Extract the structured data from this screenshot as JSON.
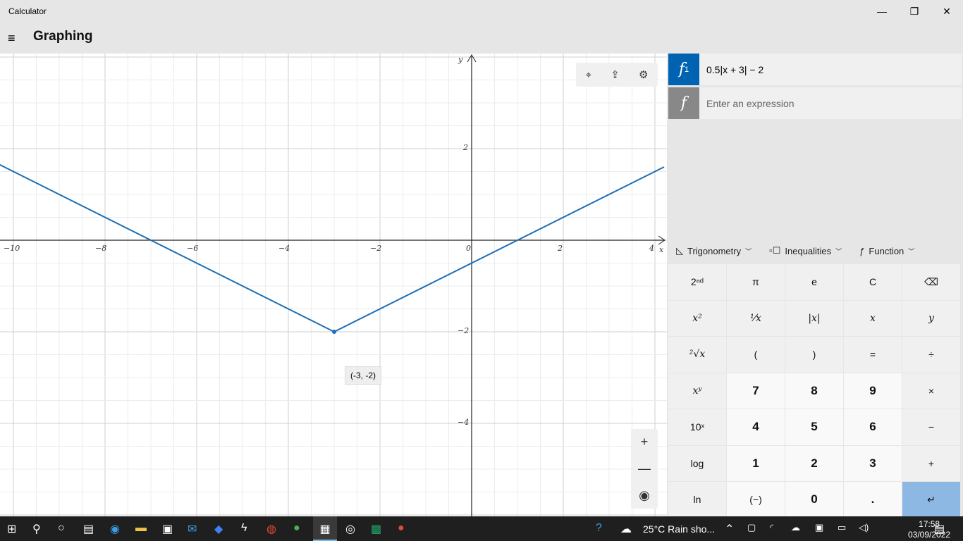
{
  "window": {
    "title": "Calculator",
    "minimize": "—",
    "maximize": "❐",
    "close": "✕"
  },
  "header": {
    "menu_icon": "≡",
    "title": "Graphing"
  },
  "graph": {
    "x_ticks": [
      "−10",
      "−8",
      "−6",
      "−4",
      "−2",
      "0",
      "2",
      "4"
    ],
    "y_ticks": [
      "2",
      "−2",
      "−4"
    ],
    "x_label": "x",
    "y_label": "y",
    "tooltip": "(-3, -2)",
    "toolbar": [
      "⌖",
      "⇪",
      "⚙"
    ],
    "zoom": [
      "+",
      "—",
      "◉"
    ],
    "line_color": "#1c6fb5"
  },
  "chart_data": {
    "type": "line",
    "function": "0.5|x + 3| − 2",
    "xlim": [
      -10.3,
      4.2
    ],
    "ylim": [
      -6,
      4
    ],
    "vertex": [
      -3,
      -2
    ],
    "points": [
      [
        -10.3,
        1.65
      ],
      [
        -3,
        -2
      ],
      [
        4.2,
        1.6
      ]
    ],
    "grid": true
  },
  "expressions": [
    {
      "label": "f",
      "subscript": "1",
      "value": "0.5|x + 3| − 2",
      "color": "#0063b1"
    },
    {
      "label": "f",
      "placeholder": "Enter an expression",
      "color": "#888888"
    }
  ],
  "dropdowns": [
    {
      "icon": "◺",
      "label": "Trigonometry"
    },
    {
      "icon": "▫☐",
      "label": "Inequalities"
    },
    {
      "icon": "ƒ",
      "label": "Function"
    }
  ],
  "keys": [
    "2ⁿᵈ",
    "π",
    "e",
    "C",
    "⌫",
    "x²",
    "¹⁄x",
    "|x|",
    "x",
    "y",
    "²√x",
    "(",
    ")",
    "=",
    "÷",
    "xʸ",
    "7",
    "8",
    "9",
    "×",
    "10ˣ",
    "4",
    "5",
    "6",
    "−",
    "log",
    "1",
    "2",
    "3",
    "+",
    "ln",
    "(−)",
    "0",
    ".",
    "↵"
  ],
  "taskbar": {
    "weather": "25°C  Rain sho...",
    "time": "17:58",
    "date": "03/09/2022"
  }
}
